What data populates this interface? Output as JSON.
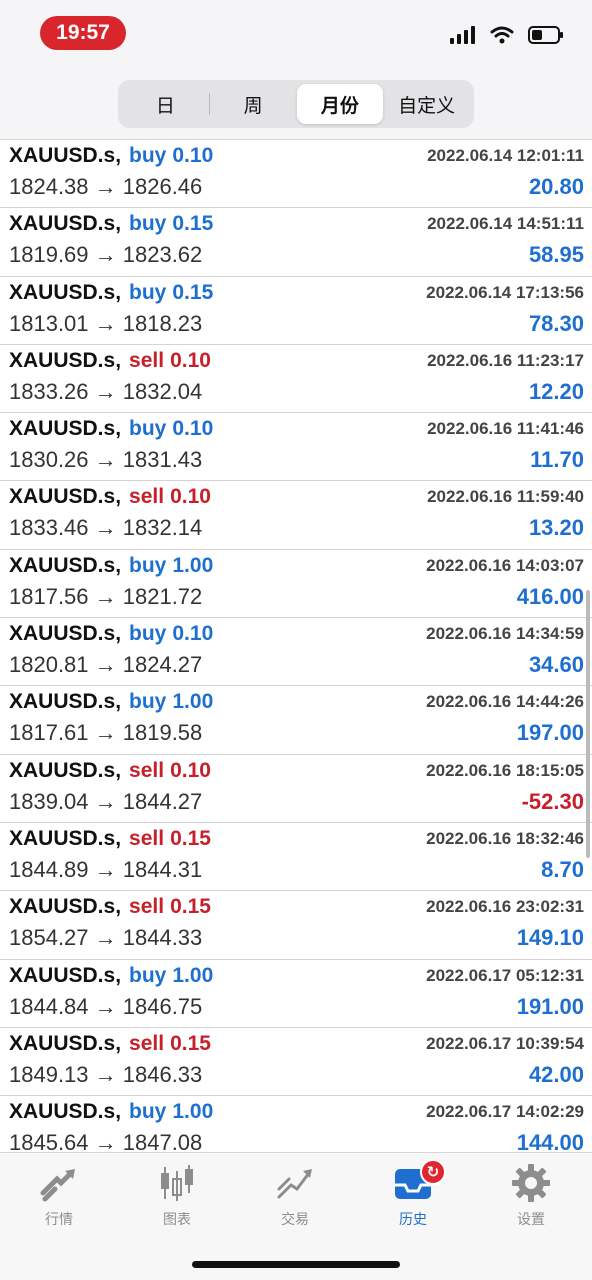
{
  "status_bar": {
    "time": "19:57"
  },
  "period_tabs": [
    {
      "label": "日",
      "active": false
    },
    {
      "label": "周",
      "active": false
    },
    {
      "label": "月份",
      "active": true
    },
    {
      "label": "自定义",
      "active": false
    }
  ],
  "deals": [
    {
      "symbol": "XAUUSD.s,",
      "side": "buy",
      "volume": "0.10",
      "datetime": "2022.06.14 12:01:11",
      "prices": "1824.38 → 1826.46",
      "profit": "20.80"
    },
    {
      "symbol": "XAUUSD.s,",
      "side": "buy",
      "volume": "0.15",
      "datetime": "2022.06.14 14:51:11",
      "prices": "1819.69 → 1823.62",
      "profit": "58.95"
    },
    {
      "symbol": "XAUUSD.s,",
      "side": "buy",
      "volume": "0.15",
      "datetime": "2022.06.14 17:13:56",
      "prices": "1813.01 → 1818.23",
      "profit": "78.30"
    },
    {
      "symbol": "XAUUSD.s,",
      "side": "sell",
      "volume": "0.10",
      "datetime": "2022.06.16 11:23:17",
      "prices": "1833.26 → 1832.04",
      "profit": "12.20"
    },
    {
      "symbol": "XAUUSD.s,",
      "side": "buy",
      "volume": "0.10",
      "datetime": "2022.06.16 11:41:46",
      "prices": "1830.26 → 1831.43",
      "profit": "11.70"
    },
    {
      "symbol": "XAUUSD.s,",
      "side": "sell",
      "volume": "0.10",
      "datetime": "2022.06.16 11:59:40",
      "prices": "1833.46 → 1832.14",
      "profit": "13.20"
    },
    {
      "symbol": "XAUUSD.s,",
      "side": "buy",
      "volume": "1.00",
      "datetime": "2022.06.16 14:03:07",
      "prices": "1817.56 → 1821.72",
      "profit": "416.00"
    },
    {
      "symbol": "XAUUSD.s,",
      "side": "buy",
      "volume": "0.10",
      "datetime": "2022.06.16 14:34:59",
      "prices": "1820.81 → 1824.27",
      "profit": "34.60"
    },
    {
      "symbol": "XAUUSD.s,",
      "side": "buy",
      "volume": "1.00",
      "datetime": "2022.06.16 14:44:26",
      "prices": "1817.61 → 1819.58",
      "profit": "197.00"
    },
    {
      "symbol": "XAUUSD.s,",
      "side": "sell",
      "volume": "0.10",
      "datetime": "2022.06.16 18:15:05",
      "prices": "1839.04 → 1844.27",
      "profit": "-52.30"
    },
    {
      "symbol": "XAUUSD.s,",
      "side": "sell",
      "volume": "0.15",
      "datetime": "2022.06.16 18:32:46",
      "prices": "1844.89 → 1844.31",
      "profit": "8.70"
    },
    {
      "symbol": "XAUUSD.s,",
      "side": "sell",
      "volume": "0.15",
      "datetime": "2022.06.16 23:02:31",
      "prices": "1854.27 → 1844.33",
      "profit": "149.10"
    },
    {
      "symbol": "XAUUSD.s,",
      "side": "buy",
      "volume": "1.00",
      "datetime": "2022.06.17 05:12:31",
      "prices": "1844.84 → 1846.75",
      "profit": "191.00"
    },
    {
      "symbol": "XAUUSD.s,",
      "side": "sell",
      "volume": "0.15",
      "datetime": "2022.06.17 10:39:54",
      "prices": "1849.13 → 1846.33",
      "profit": "42.00"
    },
    {
      "symbol": "XAUUSD.s,",
      "side": "buy",
      "volume": "1.00",
      "datetime": "2022.06.17 14:02:29",
      "prices": "1845.64 → 1847.08",
      "profit": "144.00"
    }
  ],
  "tab_bar": [
    {
      "label": "行情",
      "icon": "quotes-icon",
      "active": false
    },
    {
      "label": "图表",
      "icon": "chart-candles-icon",
      "active": false
    },
    {
      "label": "交易",
      "icon": "trade-icon",
      "active": false
    },
    {
      "label": "历史",
      "icon": "history-inbox-icon",
      "active": true
    },
    {
      "label": "设置",
      "icon": "gear-icon",
      "active": false
    }
  ],
  "colors": {
    "buy": "#1e6fd0",
    "sell": "#c8202a",
    "active_tab": "#1e6fd0",
    "time_pill": "#d8262c"
  }
}
